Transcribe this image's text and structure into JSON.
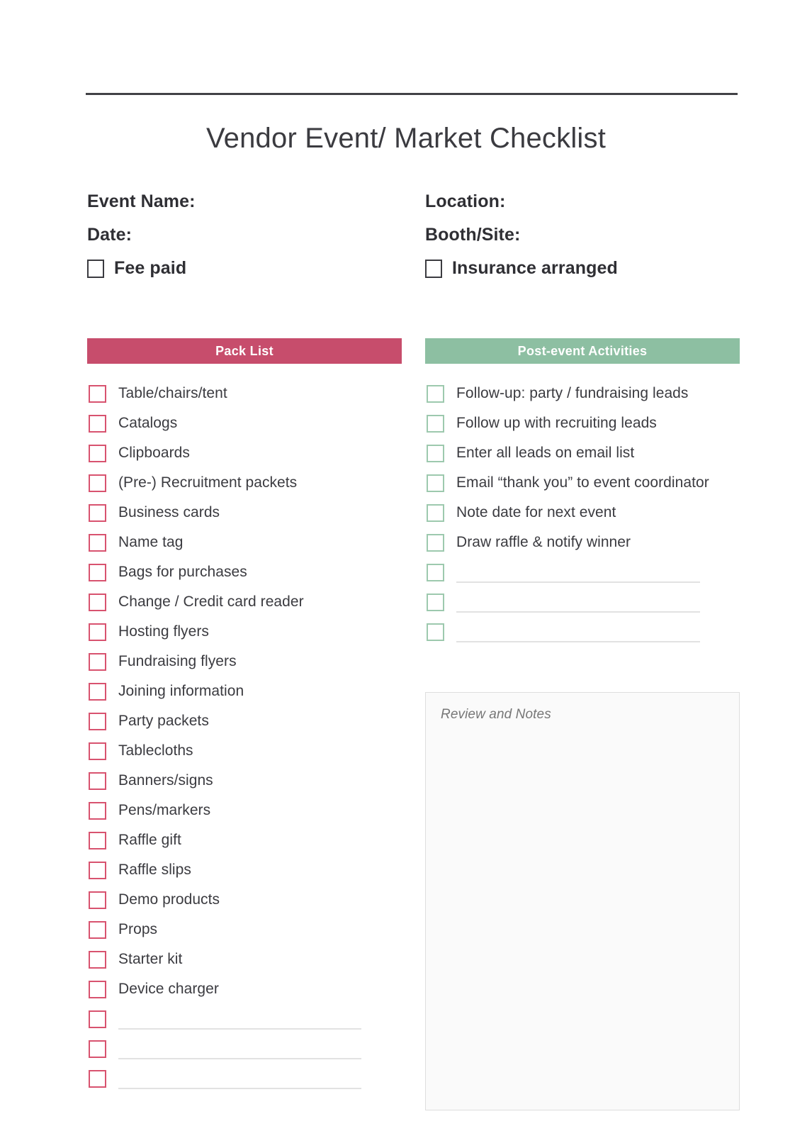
{
  "document": {
    "title": "Vendor Event/ Market Checklist"
  },
  "meta": {
    "event_name_label": "Event Name:",
    "location_label": "Location:",
    "date_label": "Date:",
    "booth_site_label": "Booth/Site:",
    "fee_paid_label": "Fee paid",
    "insurance_label": "Insurance arranged"
  },
  "pack_list": {
    "heading": "Pack List",
    "accent": "#c74d6c",
    "checkbox_border": "#d8536f",
    "items": [
      "Table/chairs/tent",
      "Catalogs",
      "Clipboards",
      "(Pre-) Recruitment packets",
      "Business cards",
      "Name tag",
      "Bags for purchases",
      "Change / Credit card reader",
      "Hosting flyers",
      "Fundraising flyers",
      "Joining information",
      "Party packets",
      "Tablecloths",
      "Banners/signs",
      "Pens/markers",
      "Raffle gift",
      "Raffle slips",
      "Demo products",
      "Props",
      "Starter kit",
      "Device charger"
    ],
    "blank_lines": 3
  },
  "post_event": {
    "heading": "Post-event Activities",
    "accent": "#8dbfa2",
    "checkbox_border": "#9dc9ae",
    "items": [
      "Follow-up: party / fundraising leads",
      "Follow up with recruiting leads",
      "Enter all leads on email list",
      "Email “thank you” to event coordinator",
      "Note date for next event",
      "Draw raffle & notify winner"
    ],
    "blank_lines": 3
  },
  "notes": {
    "placeholder": "Review and Notes"
  }
}
